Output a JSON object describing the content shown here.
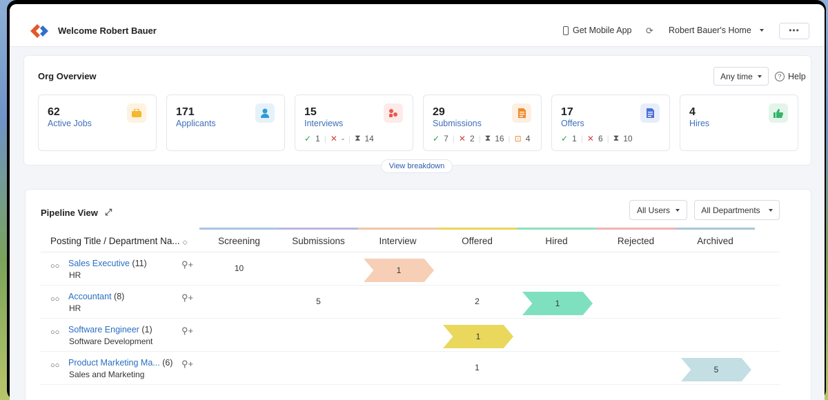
{
  "header": {
    "welcome": "Welcome Robert Bauer",
    "mobile_app": "Get Mobile App",
    "home": "Robert Bauer's Home",
    "more": "•••"
  },
  "org": {
    "title": "Org Overview",
    "range": "Any time",
    "help": "Help",
    "view_breakdown": "View breakdown",
    "cards": [
      {
        "num": "62",
        "label": "Active Jobs",
        "icon": "briefcase-icon",
        "color": "#f5b82e",
        "bg": "#fdf3e0"
      },
      {
        "num": "171",
        "label": "Applicants",
        "icon": "person-icon",
        "color": "#2e9bd6",
        "bg": "#e6f2fa"
      },
      {
        "num": "15",
        "label": "Interviews",
        "icon": "group-icon",
        "color": "#e85a4f",
        "bg": "#fcebe9",
        "stats": {
          "ok": "1",
          "no": "-",
          "pending": "14"
        }
      },
      {
        "num": "29",
        "label": "Submissions",
        "icon": "document-icon",
        "color": "#f08b2c",
        "bg": "#fdefe2",
        "stats": {
          "ok": "7",
          "no": "2",
          "pending": "16",
          "other": "4"
        }
      },
      {
        "num": "17",
        "label": "Offers",
        "icon": "offer-icon",
        "color": "#4a6fd6",
        "bg": "#e8edfb",
        "stats": {
          "ok": "1",
          "no": "6",
          "pending": "10"
        }
      },
      {
        "num": "4",
        "label": "Hires",
        "icon": "thumbs-up-icon",
        "color": "#35b36a",
        "bg": "#e3f5ea"
      }
    ]
  },
  "pipeline": {
    "title": "Pipeline View",
    "users_filter": "All Users",
    "dept_filter": "All Departments",
    "posting_header": "Posting Title / Department Na...",
    "stages": [
      {
        "name": "Screening",
        "color": "#a9c4e4"
      },
      {
        "name": "Submissions",
        "color": "#b9b6df"
      },
      {
        "name": "Interview",
        "color": "#f2c6a5"
      },
      {
        "name": "Offered",
        "color": "#e7d75a"
      },
      {
        "name": "Hired",
        "color": "#8ee0c0"
      },
      {
        "name": "Rejected",
        "color": "#f2b1b1"
      },
      {
        "name": "Archived",
        "color": "#a9c7d4"
      }
    ],
    "rows": [
      {
        "title": "Sales Executive",
        "count": "(11)",
        "dept": "HR",
        "cells": {
          "Screening": "10"
        },
        "highlight": {
          "stage": "Interview",
          "value": "1",
          "color": "#f6cfb6"
        }
      },
      {
        "title": "Accountant",
        "count": "(8)",
        "dept": "HR",
        "cells": {
          "Submissions": "5",
          "Offered": "2"
        },
        "highlight": {
          "stage": "Hired",
          "value": "1",
          "color": "#7fe0bf"
        }
      },
      {
        "title": "Software Engineer",
        "count": "(1)",
        "dept": "Software Development",
        "cells": {},
        "highlight": {
          "stage": "Offered",
          "value": "1",
          "color": "#e9d85c"
        }
      },
      {
        "title": "Product Marketing Ma...",
        "count": "(6)",
        "dept": "Sales and Marketing",
        "cells": {
          "Offered": "1"
        },
        "highlight": {
          "stage": "Archived",
          "value": "5",
          "color": "#c3dfe4"
        }
      }
    ]
  }
}
